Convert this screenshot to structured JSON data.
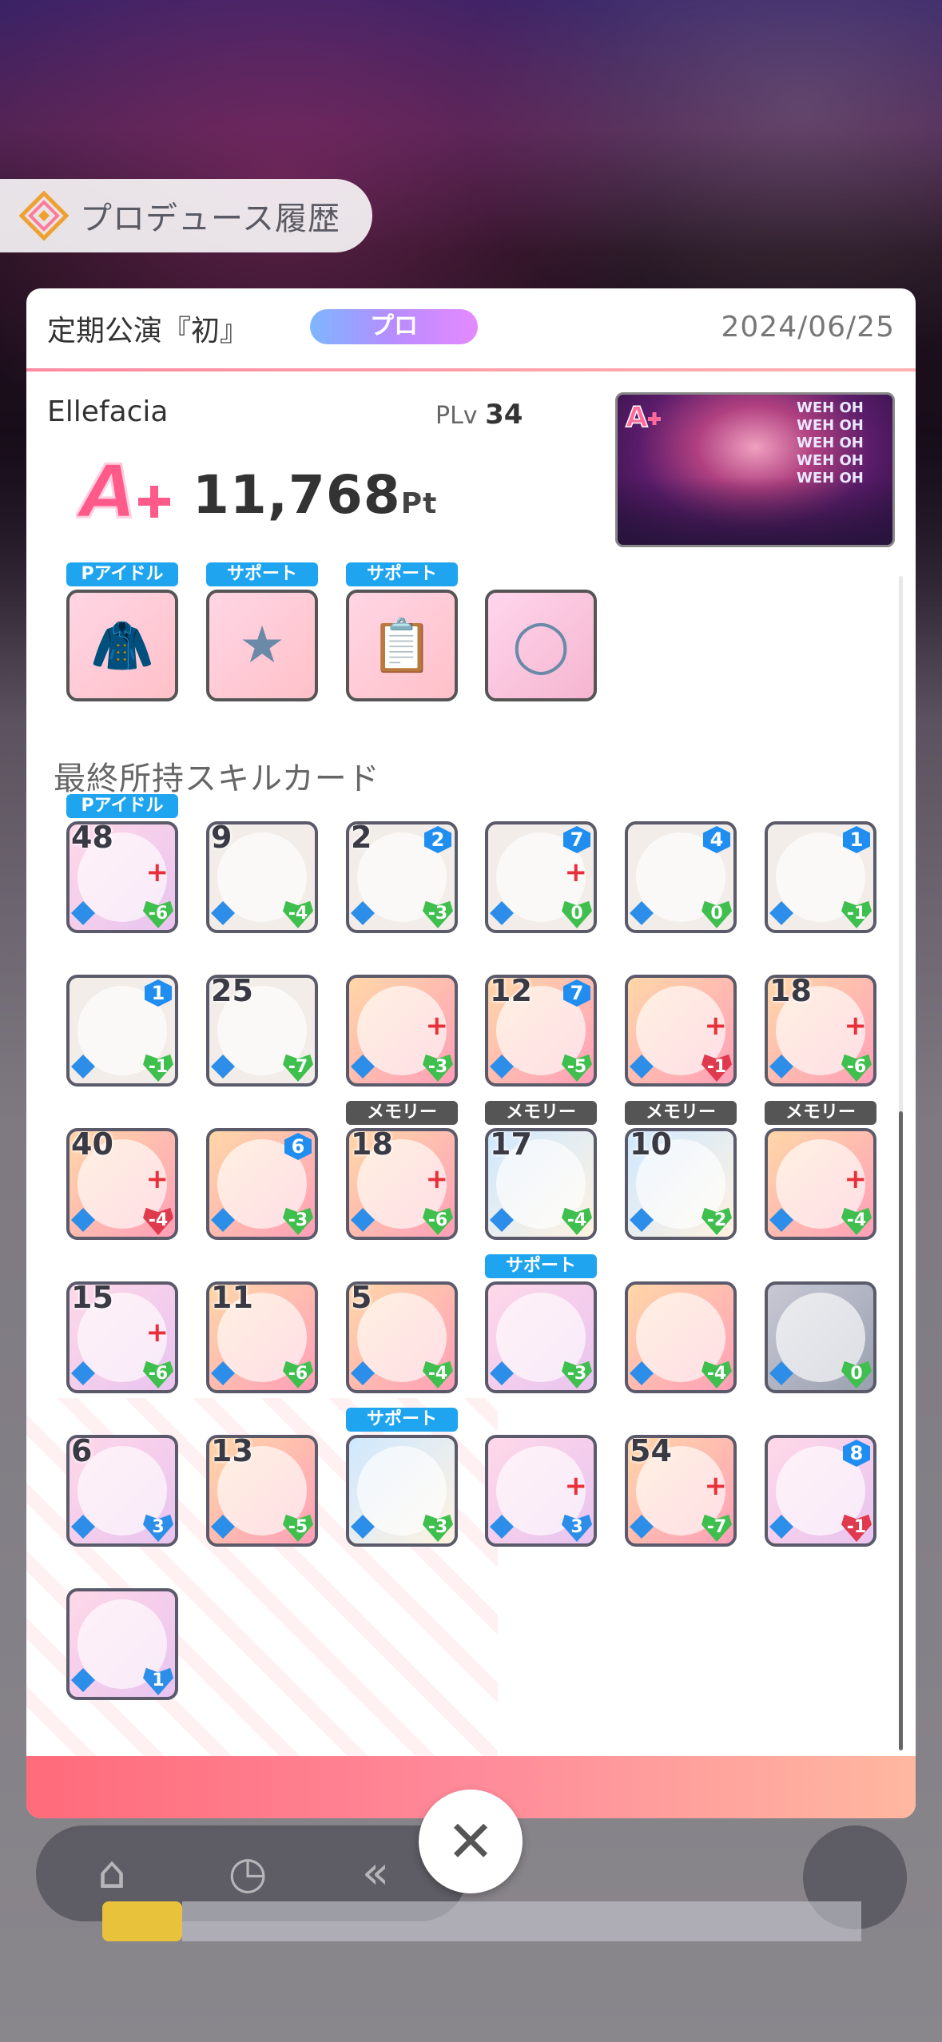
{
  "header": {
    "title": "プロデュース履歴"
  },
  "panel": {
    "event_title": "定期公演『初』",
    "difficulty": "プロ",
    "date": "2024/06/25",
    "idol_name": "Ellefacia",
    "plv_label": "PLv",
    "plv_value": "34",
    "grade": "A+",
    "score": "11,768",
    "score_unit": "Pt",
    "thumbnail_text": "WEH OH WEH OH WEH OH WEH OH WEH OH"
  },
  "items": [
    {
      "tag": "Pアイドル",
      "icon": "jacket-icon"
    },
    {
      "tag": "サポート",
      "icon": "chain-star-icon"
    },
    {
      "tag": "サポート",
      "icon": "clipboard-icon"
    },
    {
      "tag": "",
      "icon": "bracelet-icon"
    }
  ],
  "skill_section_title": "最終所持スキルカード",
  "skill_cards": [
    {
      "count": "48",
      "lv": "",
      "cost": "-6",
      "cost_color": "green",
      "tag": "Pアイドル",
      "style": "pink",
      "plus": true
    },
    {
      "count": "9",
      "lv": "",
      "cost": "-4",
      "cost_color": "green",
      "tag": "",
      "style": "mental",
      "plus": false
    },
    {
      "count": "2",
      "lv": "2",
      "cost": "-3",
      "cost_color": "green",
      "tag": "",
      "style": "mental",
      "plus": false
    },
    {
      "count": "",
      "lv": "7",
      "cost": "0",
      "cost_color": "green",
      "tag": "",
      "style": "mental",
      "plus": true
    },
    {
      "count": "",
      "lv": "4",
      "cost": "0",
      "cost_color": "green",
      "tag": "",
      "style": "mental",
      "plus": false
    },
    {
      "count": "",
      "lv": "1",
      "cost": "-1",
      "cost_color": "green",
      "tag": "",
      "style": "mental",
      "plus": false
    },
    {
      "count": "",
      "lv": "1",
      "cost": "-1",
      "cost_color": "green",
      "tag": "",
      "style": "mental",
      "plus": false
    },
    {
      "count": "25",
      "lv": "",
      "cost": "-7",
      "cost_color": "green",
      "tag": "",
      "style": "mental",
      "plus": false
    },
    {
      "count": "",
      "lv": "",
      "cost": "-3",
      "cost_color": "green",
      "tag": "",
      "style": "active",
      "plus": true
    },
    {
      "count": "12",
      "lv": "7",
      "cost": "-5",
      "cost_color": "green",
      "tag": "",
      "style": "active",
      "plus": false
    },
    {
      "count": "",
      "lv": "",
      "cost": "-1",
      "cost_color": "red",
      "tag": "",
      "style": "active",
      "plus": true
    },
    {
      "count": "18",
      "lv": "",
      "cost": "-6",
      "cost_color": "green",
      "tag": "",
      "style": "active",
      "plus": true
    },
    {
      "count": "40",
      "lv": "",
      "cost": "-4",
      "cost_color": "red",
      "tag": "",
      "style": "active",
      "plus": true
    },
    {
      "count": "",
      "lv": "6",
      "cost": "-3",
      "cost_color": "green",
      "tag": "",
      "style": "active",
      "plus": false
    },
    {
      "count": "18",
      "lv": "",
      "cost": "-6",
      "cost_color": "green",
      "tag": "メモリー",
      "style": "active",
      "plus": true
    },
    {
      "count": "17",
      "lv": "",
      "cost": "-4",
      "cost_color": "green",
      "tag": "メモリー",
      "style": "blue",
      "plus": false
    },
    {
      "count": "10",
      "lv": "",
      "cost": "-2",
      "cost_color": "green",
      "tag": "メモリー",
      "style": "blue",
      "plus": false
    },
    {
      "count": "",
      "lv": "",
      "cost": "-4",
      "cost_color": "green",
      "tag": "メモリー",
      "style": "active",
      "plus": true
    },
    {
      "count": "15",
      "lv": "",
      "cost": "-6",
      "cost_color": "green",
      "tag": "",
      "style": "pink",
      "plus": true
    },
    {
      "count": "11",
      "lv": "",
      "cost": "-6",
      "cost_color": "green",
      "tag": "",
      "style": "active",
      "plus": false
    },
    {
      "count": "5",
      "lv": "",
      "cost": "-4",
      "cost_color": "green",
      "tag": "",
      "style": "active",
      "plus": false
    },
    {
      "count": "",
      "lv": "",
      "cost": "-3",
      "cost_color": "green",
      "tag": "サポート",
      "style": "pink",
      "plus": false
    },
    {
      "count": "",
      "lv": "",
      "cost": "-4",
      "cost_color": "green",
      "tag": "",
      "style": "active",
      "plus": false
    },
    {
      "count": "",
      "lv": "",
      "cost": "0",
      "cost_color": "green",
      "tag": "",
      "style": "gray",
      "plus": false
    },
    {
      "count": "6",
      "lv": "",
      "cost": "3",
      "cost_color": "blue",
      "tag": "",
      "style": "pink",
      "plus": false
    },
    {
      "count": "13",
      "lv": "",
      "cost": "-5",
      "cost_color": "green",
      "tag": "",
      "style": "active",
      "plus": false
    },
    {
      "count": "",
      "lv": "",
      "cost": "-3",
      "cost_color": "green",
      "tag": "サポート",
      "style": "blue",
      "plus": false
    },
    {
      "count": "",
      "lv": "",
      "cost": "3",
      "cost_color": "blue",
      "tag": "",
      "style": "pink",
      "plus": true
    },
    {
      "count": "54",
      "lv": "",
      "cost": "-7",
      "cost_color": "green",
      "tag": "",
      "style": "active",
      "plus": true
    },
    {
      "count": "",
      "lv": "8",
      "cost": "-1",
      "cost_color": "red",
      "tag": "",
      "style": "pink",
      "plus": false
    },
    {
      "count": "",
      "lv": "",
      "cost": "1",
      "cost_color": "blue",
      "tag": "",
      "style": "pink",
      "plus": false
    }
  ],
  "close_label": "✕",
  "colors": {
    "accent_pink": "#ff6b7a",
    "tag_blue": "#1fa5f0",
    "tag_memory": "#555555",
    "cost_green": "#3fbf4e",
    "cost_red": "#e03a4e"
  }
}
